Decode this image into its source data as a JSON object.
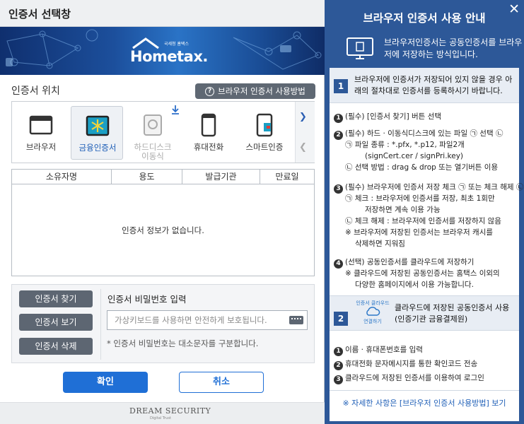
{
  "dialog": {
    "title": "인증서 선택창",
    "logo": "Hometax.",
    "logo_sub": "국세청 홈택스",
    "location_label": "인증서 위치",
    "help_button": "브라우저 인증서 사용방법",
    "locations": [
      {
        "label": "브라우저",
        "icon": "browser-icon",
        "selected": false,
        "disabled": false
      },
      {
        "label": "금융인증서",
        "icon": "financial-cert-icon",
        "selected": true,
        "disabled": false
      },
      {
        "label": "하드디스크\n이동식",
        "icon": "hard-disk-icon",
        "selected": false,
        "disabled": true
      },
      {
        "label": "휴대전화",
        "icon": "mobile-phone-icon",
        "selected": false,
        "disabled": false
      },
      {
        "label": "스마트인증",
        "icon": "smart-cert-icon",
        "selected": false,
        "disabled": false
      }
    ],
    "table": {
      "columns": [
        "소유자명",
        "용도",
        "발급기관",
        "만료일"
      ],
      "empty_message": "인증서 정보가 없습니다."
    },
    "buttons": {
      "find": "인증서 찾기",
      "view": "인증서 보기",
      "delete": "인증서 삭제",
      "ok": "확인",
      "cancel": "취소"
    },
    "password": {
      "label": "인증서 비밀번호 입력",
      "placeholder": "가상키보드를 사용하면 안전하게 보호됩니다.",
      "note": "* 인증서 비밀번호는 대소문자를 구분합니다."
    },
    "footer": {
      "brand": "DREAM SECURITY",
      "tagline": "Digital Trust"
    }
  },
  "guide": {
    "title": "브라우저 인증서 사용 안내",
    "intro": "브라우저인증서는 공동인증서를 브라우저에 저장하는 방식입니다.",
    "step1": {
      "num": "1",
      "text": "브라우저에 인증서가 저장되어 있지 않을 경우 아래의 절차대로 인증서를 등록하시기 바랍니다.",
      "items": [
        {
          "n": "1",
          "text": "(필수) [인증서 찾기] 버튼 선택"
        },
        {
          "n": "2",
          "text": "(필수) 하드 · 이동식디스크에 있는 파일 ㉠ 선택 ㉡"
        },
        {
          "n": "",
          "text": "㉠ 파일 종류 : *.pfx, *.p12, 파일2개"
        },
        {
          "n": "",
          "text": "(signCert.cer / signPri.key)"
        },
        {
          "n": "",
          "text": "㉡ 선택 방법 : drag & drop 또는 열기버튼 이용"
        },
        {
          "n": "3",
          "text": "(필수) 브라우저에 인증서 저장 체크 ㉠ 또는 체크 해제 ㉡"
        },
        {
          "n": "",
          "text": "㉠ 체크 : 브라우저에 인증서를 저장, 최초 1회만"
        },
        {
          "n": "",
          "text": "저장하면 계속 이용 가능"
        },
        {
          "n": "",
          "text": "㉡ 체크 해제 : 브라우저에 인증서를 저장하지 않음"
        },
        {
          "n": "",
          "text": "※ 브라우저에 저장된 인증서는 브라우저 캐시를"
        },
        {
          "n": "",
          "text": "삭제하면 지워짐"
        },
        {
          "n": "4",
          "text": "(선택) 공동인증서를 클라우드에 저장하기"
        },
        {
          "n": "",
          "text": "※ 클라우드에 저장된 공동인증서는 홈택스 이외의"
        },
        {
          "n": "",
          "text": "다양한 홈페이지에서 이용 가능합니다."
        }
      ]
    },
    "step2": {
      "num": "2",
      "logo_top": "인증서 클라우드",
      "logo_bottom": "연결하기",
      "text": "클라우드에 저장된 공동인증서 사용 (인증기관 금융결제원)",
      "items": [
        {
          "n": "1",
          "text": "이름 · 휴대폰번호를 입력"
        },
        {
          "n": "2",
          "text": "휴대전화 문자메시지를 통한 확인코드 전송"
        },
        {
          "n": "3",
          "text": "클라우드에 저장된 인증서를 이용하여 로그인"
        }
      ]
    },
    "more": "※ 자세한 사항은 [브라우저 인증서 사용방법] 보기"
  }
}
